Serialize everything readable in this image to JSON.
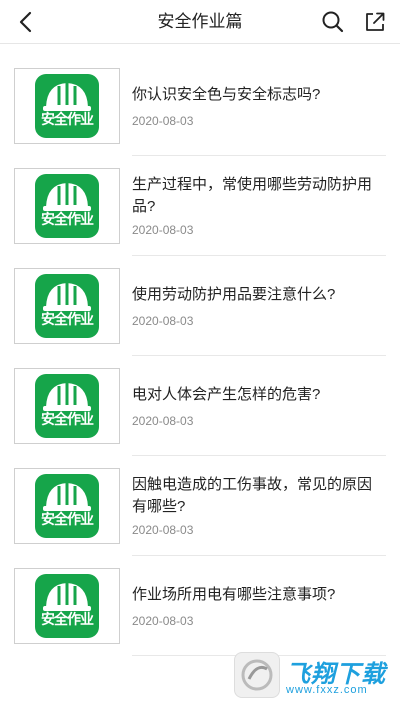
{
  "header": {
    "title": "安全作业篇",
    "back_icon": "chevron-left-icon",
    "search_icon": "search-icon",
    "share_icon": "share-icon"
  },
  "articles": [
    {
      "title": "你认识安全色与安全标志吗?",
      "date": "2020-08-03",
      "thumb_text": "安全作业"
    },
    {
      "title": "生产过程中，常使用哪些劳动防护用品?",
      "date": "2020-08-03",
      "thumb_text": "安全作业"
    },
    {
      "title": "使用劳动防护用品要注意什么?",
      "date": "2020-08-03",
      "thumb_text": "安全作业"
    },
    {
      "title": "电对人体会产生怎样的危害?",
      "date": "2020-08-03",
      "thumb_text": "安全作业"
    },
    {
      "title": "因触电造成的工伤事故，常见的原因有哪些?",
      "date": "2020-08-03",
      "thumb_text": "安全作业"
    },
    {
      "title": "作业场所用电有哪些注意事项?",
      "date": "2020-08-03",
      "thumb_text": "安全作业"
    }
  ],
  "watermark": {
    "brand": "飞翔下载",
    "url": "www.fxxz.com"
  },
  "colors": {
    "thumb_green": "#16a54a",
    "watermark_blue": "#1ea0de"
  }
}
